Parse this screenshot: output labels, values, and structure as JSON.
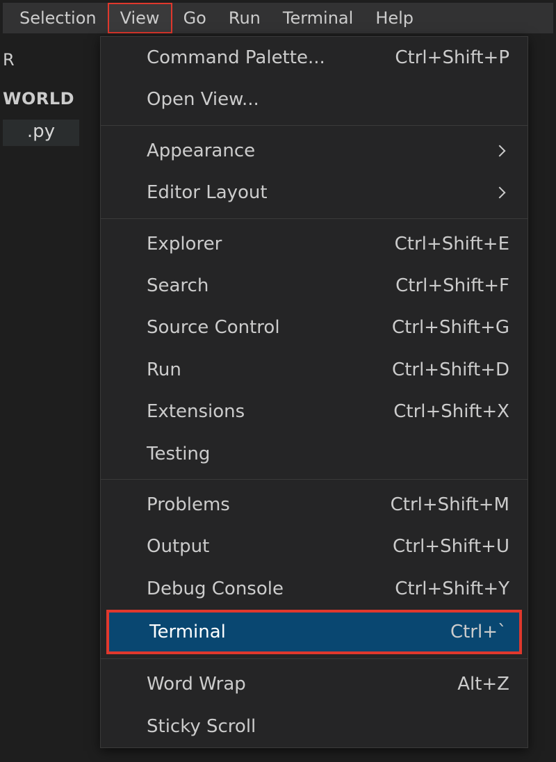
{
  "menubar": {
    "items": [
      {
        "label": "Selection",
        "active": false
      },
      {
        "label": "View",
        "active": true
      },
      {
        "label": "Go",
        "active": false
      },
      {
        "label": "Run",
        "active": false
      },
      {
        "label": "Terminal",
        "active": false
      },
      {
        "label": "Help",
        "active": false
      }
    ]
  },
  "sidebar": {
    "heading_fragment": "R",
    "project_fragment": "WORLD",
    "file_fragment": ".py"
  },
  "dropdown": {
    "groups": [
      [
        {
          "label": "Command Palette...",
          "shortcut": "Ctrl+Shift+P",
          "submenu": false,
          "highlighted": false
        },
        {
          "label": "Open View...",
          "shortcut": "",
          "submenu": false,
          "highlighted": false
        }
      ],
      [
        {
          "label": "Appearance",
          "shortcut": "",
          "submenu": true,
          "highlighted": false
        },
        {
          "label": "Editor Layout",
          "shortcut": "",
          "submenu": true,
          "highlighted": false
        }
      ],
      [
        {
          "label": "Explorer",
          "shortcut": "Ctrl+Shift+E",
          "submenu": false,
          "highlighted": false
        },
        {
          "label": "Search",
          "shortcut": "Ctrl+Shift+F",
          "submenu": false,
          "highlighted": false
        },
        {
          "label": "Source Control",
          "shortcut": "Ctrl+Shift+G",
          "submenu": false,
          "highlighted": false
        },
        {
          "label": "Run",
          "shortcut": "Ctrl+Shift+D",
          "submenu": false,
          "highlighted": false
        },
        {
          "label": "Extensions",
          "shortcut": "Ctrl+Shift+X",
          "submenu": false,
          "highlighted": false
        },
        {
          "label": "Testing",
          "shortcut": "",
          "submenu": false,
          "highlighted": false
        }
      ],
      [
        {
          "label": "Problems",
          "shortcut": "Ctrl+Shift+M",
          "submenu": false,
          "highlighted": false
        },
        {
          "label": "Output",
          "shortcut": "Ctrl+Shift+U",
          "submenu": false,
          "highlighted": false
        },
        {
          "label": "Debug Console",
          "shortcut": "Ctrl+Shift+Y",
          "submenu": false,
          "highlighted": false
        },
        {
          "label": "Terminal",
          "shortcut": "Ctrl+`",
          "submenu": false,
          "highlighted": true
        }
      ],
      [
        {
          "label": "Word Wrap",
          "shortcut": "Alt+Z",
          "submenu": false,
          "highlighted": false
        },
        {
          "label": "Sticky Scroll",
          "shortcut": "",
          "submenu": false,
          "highlighted": false
        }
      ]
    ]
  }
}
